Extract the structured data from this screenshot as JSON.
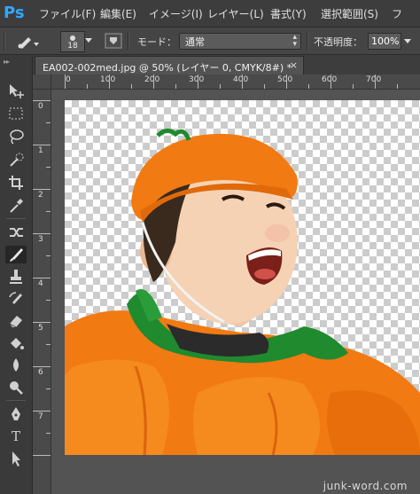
{
  "app": {
    "logo": "Ps"
  },
  "menubar": {
    "items": [
      "ファイル(F)",
      "編集(E)",
      "イメージ(I)",
      "レイヤー(L)",
      "書式(Y)",
      "選択範囲(S)",
      "フ"
    ]
  },
  "options": {
    "brush_size": "18",
    "mode_label": "モード：",
    "mode_value": "通常",
    "opacity_label": "不透明度：",
    "opacity_value": "100%"
  },
  "document": {
    "tab_title": "EA002-002med.jpg @ 50% (レイヤー 0, CMYK/8#) *",
    "close_glyph": "×"
  },
  "rulers": {
    "horizontal": [
      "0",
      "100",
      "200",
      "300",
      "400",
      "500",
      "600",
      "700"
    ],
    "vertical": [
      "0",
      "1",
      "2",
      "3",
      "4",
      "5",
      "6",
      "7"
    ]
  },
  "tools": [
    {
      "name": "move-tool",
      "icon": "move-icon"
    },
    {
      "name": "marquee-tool",
      "icon": "marquee-icon"
    },
    {
      "name": "lasso-tool",
      "icon": "lasso-icon"
    },
    {
      "name": "quick-selection-tool",
      "icon": "quick-selection-icon"
    },
    {
      "name": "crop-tool",
      "icon": "crop-icon"
    },
    {
      "name": "eyedropper-tool",
      "icon": "eyedropper-icon"
    },
    {
      "name": "healing-tool",
      "icon": "healing-icon"
    },
    {
      "name": "brush-tool",
      "icon": "brush-icon",
      "active": true
    },
    {
      "name": "clone-stamp-tool",
      "icon": "clone-stamp-icon"
    },
    {
      "name": "history-brush-tool",
      "icon": "history-brush-icon"
    },
    {
      "name": "eraser-tool",
      "icon": "eraser-icon"
    },
    {
      "name": "paint-bucket-tool",
      "icon": "paint-bucket-icon"
    },
    {
      "name": "blur-tool",
      "icon": "blur-icon"
    },
    {
      "name": "dodge-tool",
      "icon": "dodge-icon"
    },
    {
      "name": "pen-tool",
      "icon": "pen-icon"
    },
    {
      "name": "type-tool",
      "icon": "type-icon",
      "label": "T"
    },
    {
      "name": "path-selection-tool",
      "icon": "path-selection-icon"
    }
  ],
  "watermark": "junk-word.com",
  "colors": {
    "ps_blue": "#31a8ff",
    "costume_orange": "#f27a12",
    "leaf_green": "#1f8a2e"
  }
}
